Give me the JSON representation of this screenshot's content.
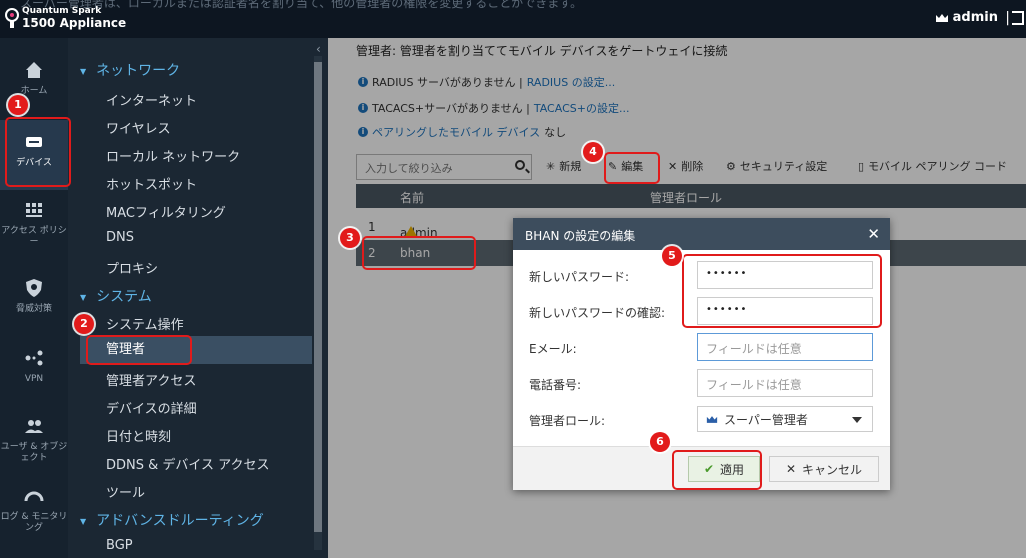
{
  "topbar": {
    "banner": "スーパー管理者は、ローカルまたは認証者名を割り当て、他の管理者の権限を変更することができます。",
    "brand": "Quantum Spark",
    "model": "1500 Appliance",
    "user": "admin",
    "divider": "|"
  },
  "leftnav": [
    {
      "name": "home",
      "label": "ホーム",
      "icon": "home-icon"
    },
    {
      "name": "device",
      "label": "デバイス",
      "icon": "device-icon",
      "active": true
    },
    {
      "name": "access-policy",
      "label": "アクセス ポリシー",
      "icon": "grid-icon"
    },
    {
      "name": "threat",
      "label": "脅威対策",
      "icon": "shield-icon"
    },
    {
      "name": "vpn",
      "label": "VPN",
      "icon": "vpn-icon"
    },
    {
      "name": "users",
      "label": "ユーザ & オブジェクト",
      "icon": "users-icon"
    },
    {
      "name": "logs",
      "label": "ログ & モニタリング",
      "icon": "gauge-icon"
    }
  ],
  "subnav": {
    "collapse": "‹",
    "sections": {
      "network": "ネットワーク",
      "system": "システム",
      "advanced_routing": "アドバンスドルーティング"
    },
    "network_items": [
      "インターネット",
      "ワイヤレス",
      "ローカル ネットワーク",
      "ホットスポット",
      "MACフィルタリング",
      "DNS",
      "プロキシ"
    ],
    "system_items": [
      "システム操作",
      "管理者",
      "管理者アクセス",
      "デバイスの詳細",
      "日付と時刻",
      "DDNS & デバイス アクセス",
      "ツール"
    ],
    "routing_items": [
      "BGP"
    ]
  },
  "main": {
    "heading": "管理者: 管理者を割り当ててモバイル デバイスをゲートウェイに接続",
    "info1_text": "RADIUS サーバがありません |",
    "info1_link": "RADIUS の設定...",
    "info2_text": "TACACS+サーバがありません |",
    "info2_link": "TACACS+の設定...",
    "info3_link": "ペアリングしたモバイル デバイス",
    "info3_text": "なし",
    "filter_placeholder": "入力して絞り込み",
    "toolbar": {
      "new": "新規",
      "edit": "編集",
      "delete": "削除",
      "security": "セキュリティ設定",
      "mobile_code": "モバイル ペアリング コード"
    },
    "table": {
      "col_name": "名前",
      "col_role": "管理者ロール",
      "rows": [
        {
          "num": "1",
          "name": "admin"
        },
        {
          "num": "2",
          "name": "bhan"
        }
      ]
    }
  },
  "dialog": {
    "title": "BHAN の設定の編集",
    "close": "✕",
    "new_password_label": "新しいパスワード:",
    "new_password_value": "••••••",
    "confirm_password_label": "新しいパスワードの確認:",
    "confirm_password_value": "••••••",
    "email_label": "Eメール:",
    "email_placeholder": "フィールドは任意",
    "phone_label": "電話番号:",
    "phone_placeholder": "フィールドは任意",
    "role_label": "管理者ロール:",
    "role_value": "スーパー管理者",
    "apply": "適用",
    "cancel": "キャンセル"
  },
  "steps": [
    "1",
    "2",
    "3",
    "4",
    "5",
    "6"
  ],
  "colors": {
    "highlight": "#e01b1b",
    "link": "#1e73be",
    "section": "#5fb4e6",
    "nav_bg": "#16222e"
  }
}
